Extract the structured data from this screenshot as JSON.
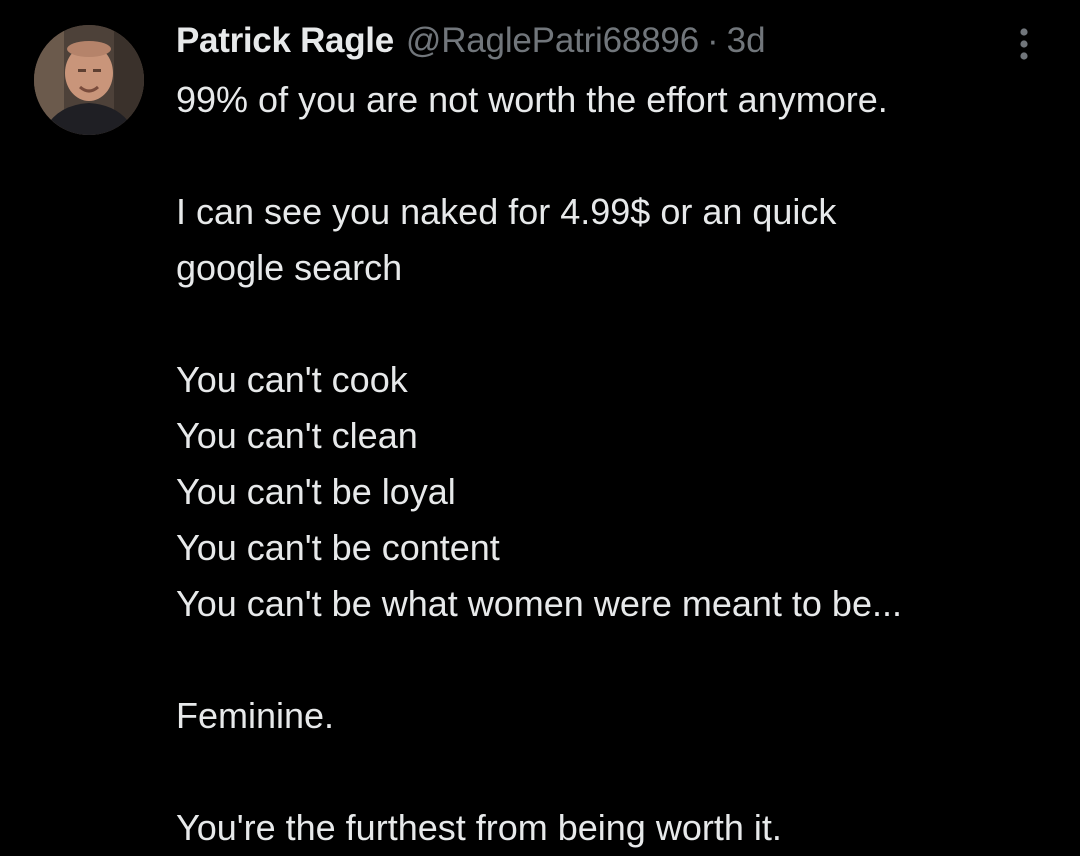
{
  "tweet": {
    "author": {
      "display_name": "Patrick Ragle",
      "handle": "@RaglePatri68896",
      "separator": "·",
      "time": "3d",
      "avatar_icon": "profile-photo"
    },
    "more_icon": "more-vertical-icon",
    "text_lines": [
      "99% of you are not worth the effort anymore.",
      "",
      "I can see you naked for 4.99$ or an quick",
      "google search",
      "",
      "You can't cook",
      "You can't clean",
      "You can't be loyal",
      "You can't be content",
      "You can't be what women were meant to be...",
      "",
      "Feminine.",
      "",
      "You're the furthest from being worth it."
    ]
  },
  "colors": {
    "background": "#000000",
    "primary_text": "#e7e9ea",
    "secondary_text": "#71767b"
  }
}
